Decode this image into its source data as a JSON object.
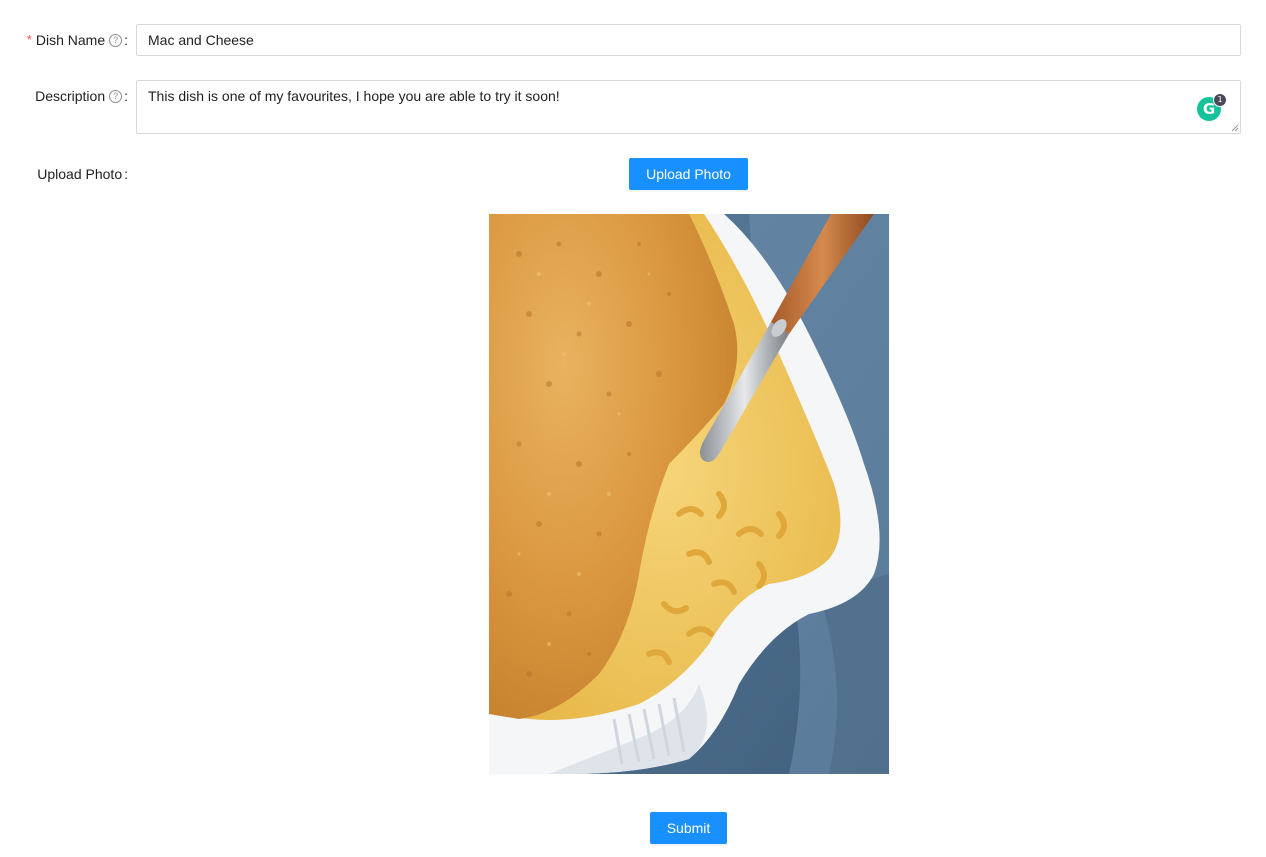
{
  "form": {
    "dish_name": {
      "required_mark": "*",
      "label": "Dish Name",
      "help_icon": "question-circle-icon",
      "colon": ":",
      "value": "Mac and Cheese"
    },
    "description": {
      "label": "Description",
      "help_icon": "question-circle-icon",
      "colon": ":",
      "value": "This dish is one of my favourites, I hope you are able to try it soon!"
    },
    "upload_photo": {
      "label": "Upload Photo",
      "colon": ":",
      "button_label": "Upload Photo"
    },
    "submit_label": "Submit"
  },
  "grammarly": {
    "icon": "grammarly-icon",
    "badge_count": "1"
  },
  "colors": {
    "primary": "#1890ff",
    "required": "#ff4d4f",
    "border": "#d9d9d9"
  }
}
